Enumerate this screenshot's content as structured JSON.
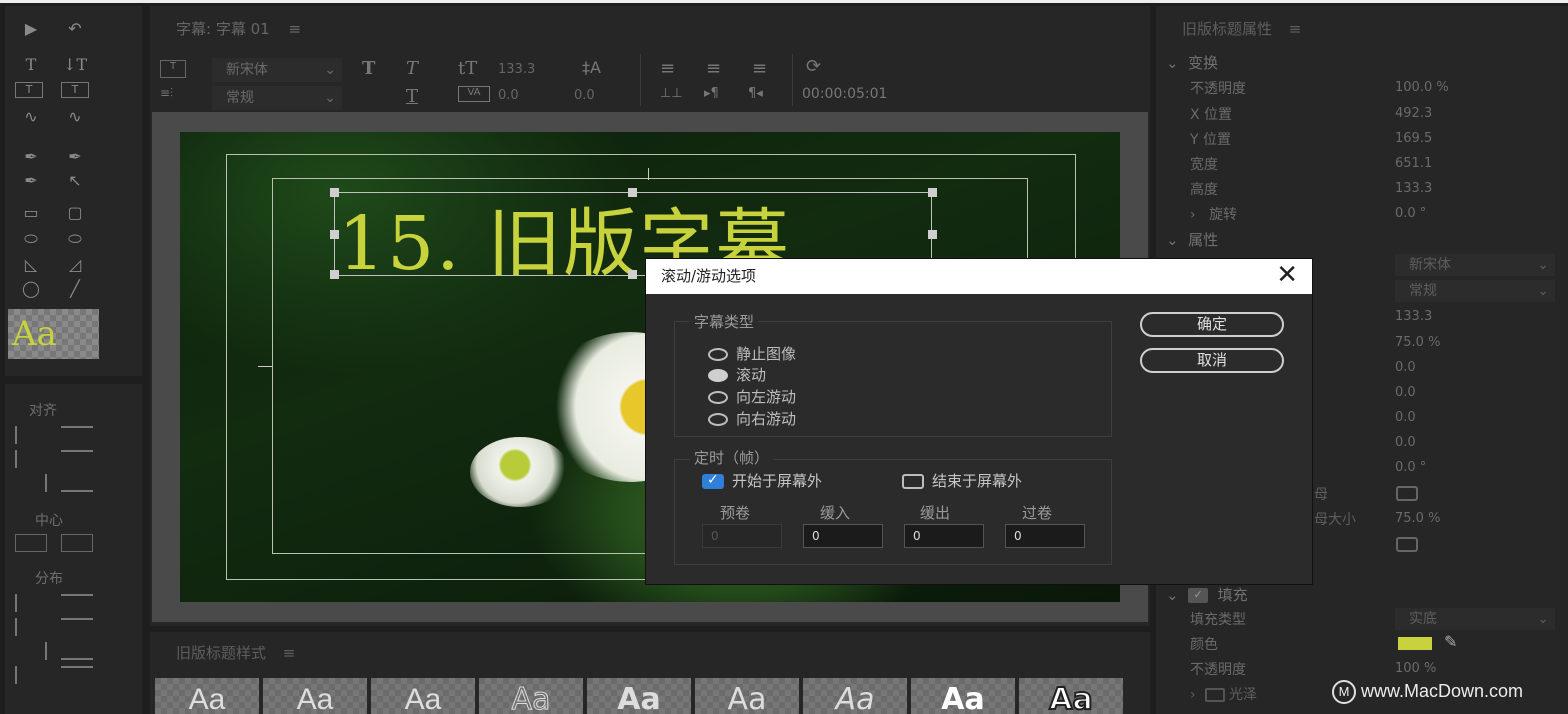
{
  "tools_panel": {
    "align_label": "对齐",
    "center_label": "中心",
    "distribute_label": "分布",
    "style_preview": "Aa"
  },
  "title_panel": {
    "tab": "字幕: 字幕 01",
    "font_family": "新宋体",
    "font_style": "常规",
    "font_size": "133.3",
    "kerning": "0.0",
    "leading": "0.0",
    "timecode": "00:00:05:01",
    "title_text": "15. 旧版字幕"
  },
  "styles_panel": {
    "title": "旧版标题样式",
    "samples": [
      "Aa",
      "Aa",
      "Aa",
      "Aa",
      "Aa",
      "Aa",
      "Aa",
      "Aa",
      "Aa"
    ]
  },
  "properties_panel": {
    "title": "旧版标题属性",
    "transform": "变换",
    "opacity_label": "不透明度",
    "opacity": "100.0 %",
    "x_label": "X 位置",
    "x": "492.3",
    "y_label": "Y 位置",
    "y": "169.5",
    "width_label": "宽度",
    "width": "651.1",
    "height_label": "高度",
    "height": "133.3",
    "rotation_label": "旋转",
    "rotation": "0.0 °",
    "attributes": "属性",
    "font_family": "新宋体",
    "font_style": "常规",
    "font_size": "133.3",
    "aspect": "75.0 %",
    "v1": "0.0",
    "v2": "0.0",
    "v3": "0.0",
    "v4": "0.0",
    "slant": "0.0 °",
    "smallcaps_partial": "母",
    "smallcaps_size_partial": "母大小",
    "smallcaps_size": "75.0 %",
    "fill": "填充",
    "fill_type_label": "填充类型",
    "fill_type": "实底",
    "color_label": "颜色",
    "fill_color": "#c8d23c",
    "fill_opacity_label": "不透明度",
    "fill_opacity": "100 %",
    "sheen": "光泽"
  },
  "dialog": {
    "title": "滚动/游动选项",
    "caption_type_label": "字幕类型",
    "options": [
      "静止图像",
      "滚动",
      "向左游动",
      "向右游动"
    ],
    "selected_index": 1,
    "ok": "确定",
    "cancel": "取消",
    "timing_label": "定时（帧）",
    "start_offscreen": "开始于屏幕外",
    "start_offscreen_checked": true,
    "end_offscreen": "结束于屏幕外",
    "end_offscreen_checked": false,
    "preroll_label": "预卷",
    "preroll": "0",
    "ease_in_label": "缓入",
    "ease_in": "0",
    "ease_out_label": "缓出",
    "ease_out": "0",
    "postroll_label": "过卷",
    "postroll": "0"
  },
  "watermark": "www.MacDown.com"
}
